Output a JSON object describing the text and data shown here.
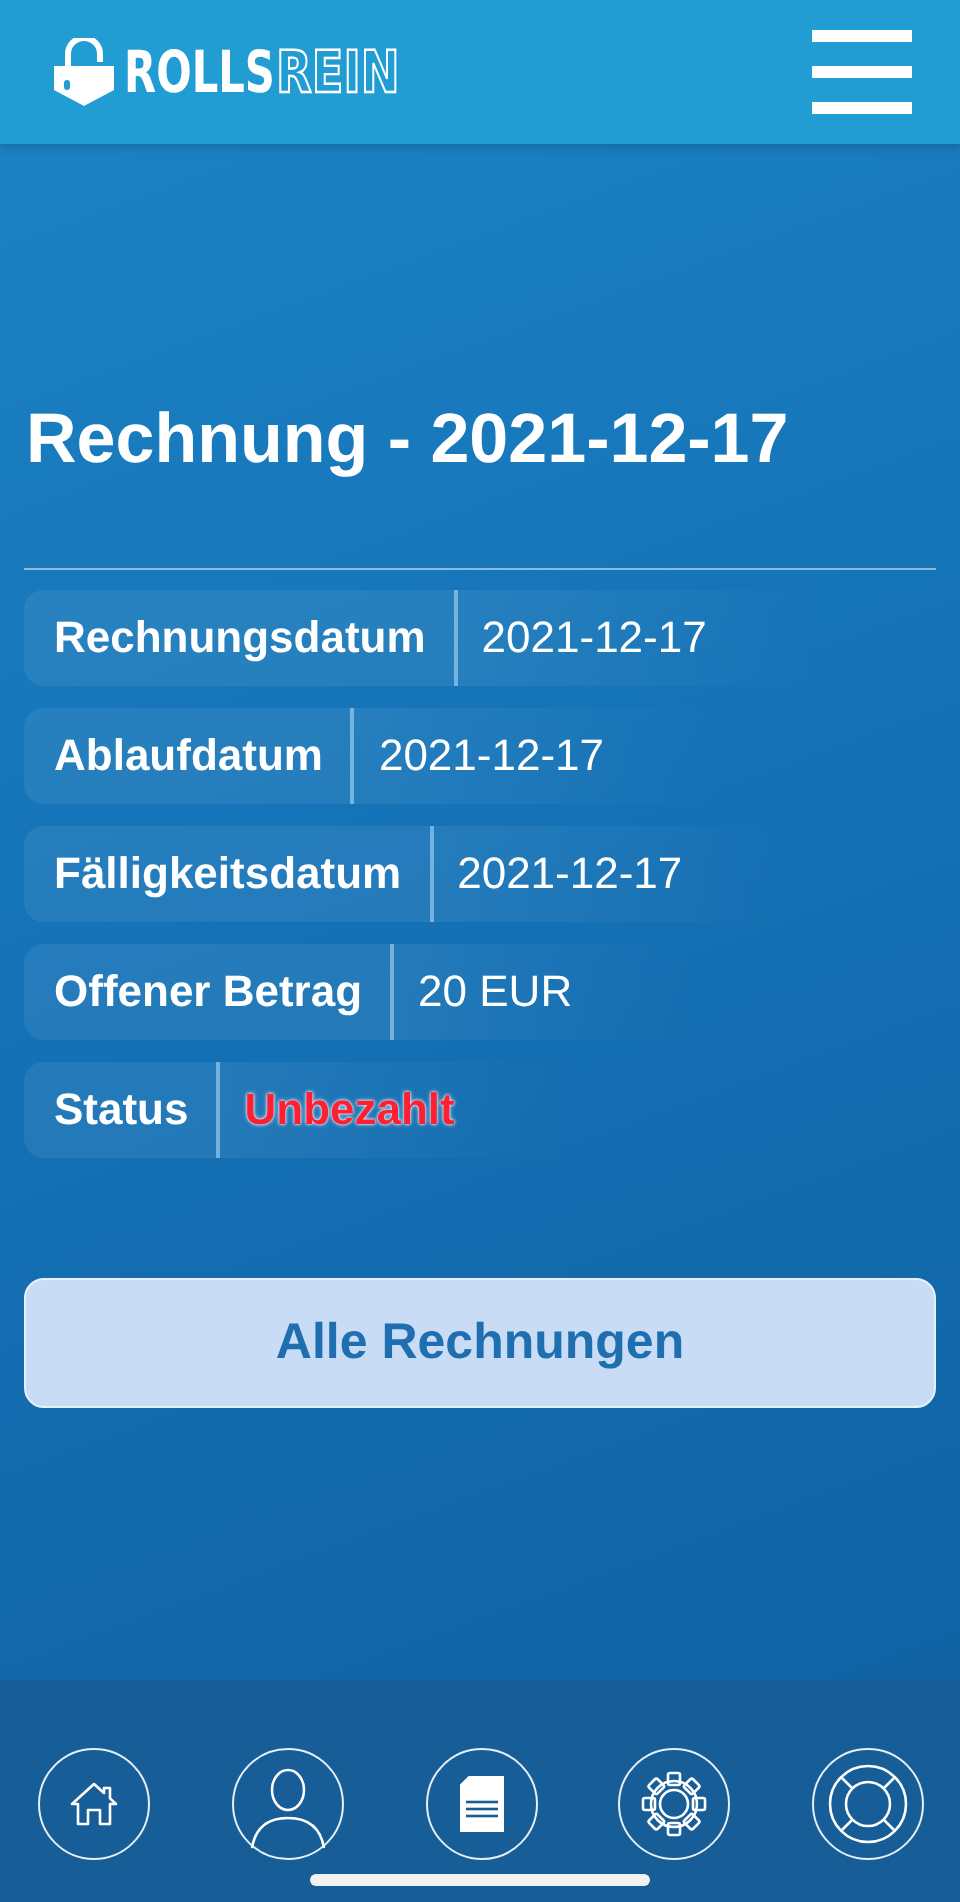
{
  "header": {
    "logo": {
      "bold": "ROLLS",
      "outline": "REIN"
    }
  },
  "title": "Rechnung - 2021-12-17",
  "details": [
    {
      "label": "Rechnungsdatum",
      "value": "2021-12-17",
      "kind": "plain"
    },
    {
      "label": "Ablaufdatum",
      "value": "2021-12-17",
      "kind": "plain"
    },
    {
      "label": "Fälligkeitsdatum",
      "value": "2021-12-17",
      "kind": "plain"
    },
    {
      "label": "Offener Betrag",
      "value": "20 EUR",
      "kind": "plain"
    },
    {
      "label": "Status",
      "value": "Unbezahlt",
      "kind": "alert"
    }
  ],
  "button": "Alle Rechnungen",
  "nav": [
    {
      "selected": false
    },
    {
      "selected": false
    },
    {
      "selected": true
    },
    {
      "selected": false
    },
    {
      "selected": false
    }
  ]
}
